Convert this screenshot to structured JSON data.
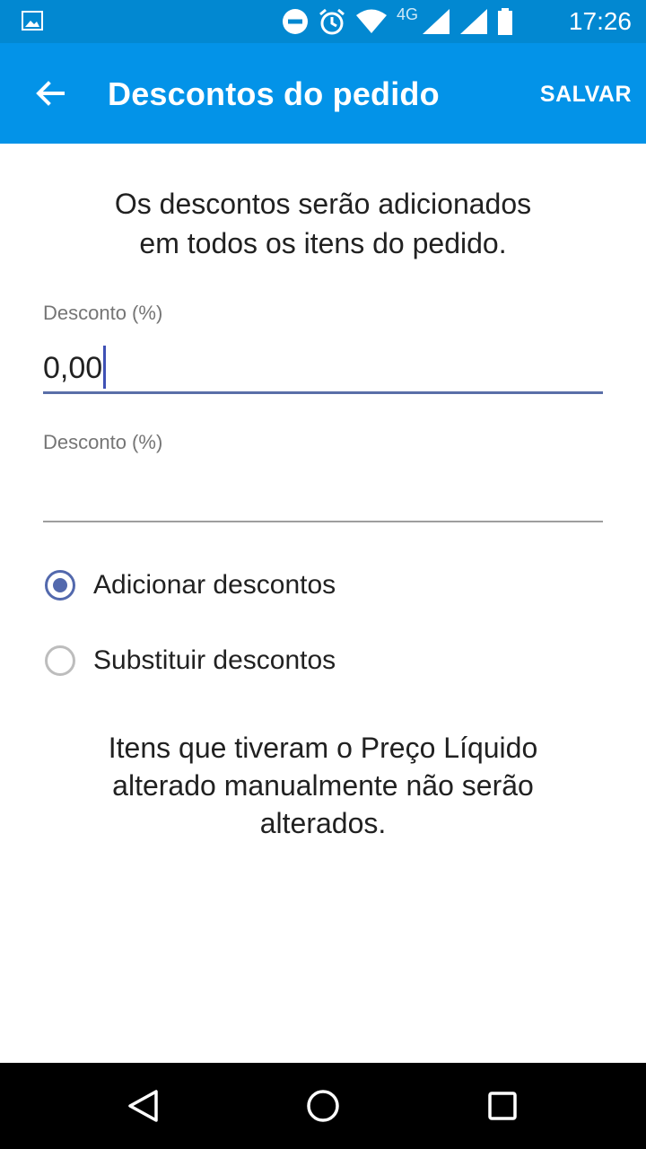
{
  "status_bar": {
    "network_label": "4G",
    "time": "17:26",
    "icons": [
      "gallery-icon",
      "do-not-disturb-icon",
      "alarm-icon",
      "wifi-icon",
      "signal-icon",
      "signal-icon",
      "battery-icon"
    ]
  },
  "app_bar": {
    "title": "Descontos do pedido",
    "save_label": "SALVAR",
    "back_icon": "arrow-left-icon",
    "background": "#0393e8"
  },
  "intro_text_line1": "Os descontos serão adicionados",
  "intro_text_line2": "em todos os itens do pedido.",
  "fields": [
    {
      "label": "Desconto (%)",
      "value": "0,00"
    },
    {
      "label": "Desconto (%)",
      "value": ""
    }
  ],
  "radio_options": [
    {
      "label": "Adicionar descontos",
      "checked": true
    },
    {
      "label": "Substituir descontos",
      "checked": false
    }
  ],
  "note_line1": "Itens que tiveram o Preço Líquido",
  "note_line2": "alterado manualmente não serão",
  "note_line3": "alterados.",
  "colors": {
    "accent": "#5369ad",
    "status_bar": "#0288d1"
  }
}
